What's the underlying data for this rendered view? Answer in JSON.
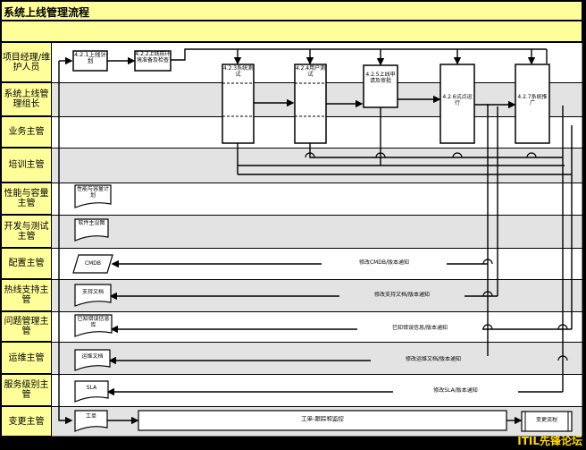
{
  "title": "系统上线管理流程",
  "lanes": [
    {
      "label": "项目经理/维护人员"
    },
    {
      "label": "系统上线管理组长"
    },
    {
      "label": "业务主管"
    },
    {
      "label": "培训主管"
    },
    {
      "label": "性能与容量主管"
    },
    {
      "label": "开发与测试主管"
    },
    {
      "label": "配置主管"
    },
    {
      "label": "热线支持主管"
    },
    {
      "label": "问题管理主管"
    },
    {
      "label": "运维主管"
    },
    {
      "label": "服务级别主管"
    },
    {
      "label": "变更主管"
    }
  ],
  "steps": {
    "s421": "4.2.1上线计划",
    "s422": "4.2.2上线前环境准备及检查",
    "s423": "4.2.3系统测试",
    "s424": "4.2.4用户测试",
    "s425": "4.2.5上线申请及审批",
    "s426": "4.2.6试点运行",
    "s427": "4.2.7系统推广"
  },
  "docs": {
    "capacity": "性能与容量计划",
    "software": "软件主设图",
    "cmdb": "CMDB",
    "support": "支持文档",
    "known_error": "已知错误信息库",
    "ops": "运维文档",
    "sla": "SLA",
    "ticket": "工单",
    "ticket_process": "工单-跟踪和监控",
    "change_process": "变更流程"
  },
  "notices": {
    "cmdb": "修改CMDB/版本通知",
    "support": "修改支持文档/版本通知",
    "known_error": "已知错误信息/版本通知",
    "ops": "修改运维文档/版本通知",
    "sla": "修改SLA/版本通知"
  },
  "watermark": "ITIL先锋论坛"
}
